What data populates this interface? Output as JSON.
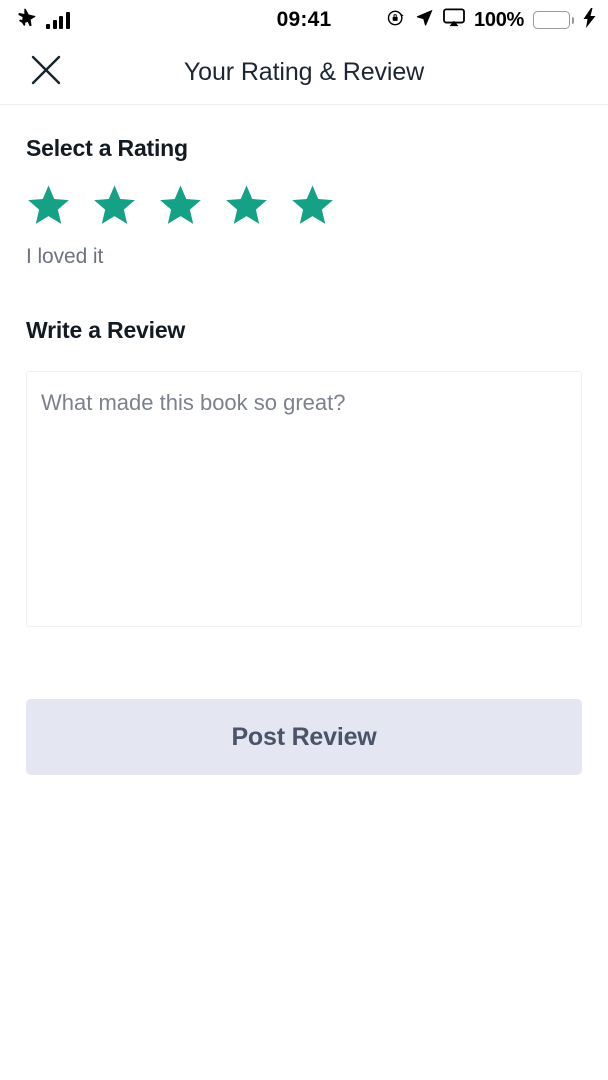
{
  "status_bar": {
    "airplane_icon": "airplane-icon",
    "signal_icon": "signal-bars-icon",
    "time": "09:41",
    "rotation_lock_icon": "rotation-lock-icon",
    "location_icon": "location-arrow-icon",
    "airplay_icon": "airplay-icon",
    "battery_percent": "100%",
    "battery_icon": "battery-icon",
    "charging_icon": "lightning-bolt-icon",
    "battery_color": "#4ACB5F"
  },
  "header": {
    "close_icon": "close-icon",
    "title": "Your Rating & Review"
  },
  "rating_section": {
    "heading": "Select a Rating",
    "stars_total": 5,
    "stars_selected": 5,
    "star_color": "#14A185",
    "label": "I loved it"
  },
  "review_section": {
    "heading": "Write a Review",
    "placeholder": "What made this book so great?",
    "value": ""
  },
  "actions": {
    "post_label": "Post Review",
    "post_bg": "#E4E7F2",
    "post_text_color": "#4B5368"
  }
}
